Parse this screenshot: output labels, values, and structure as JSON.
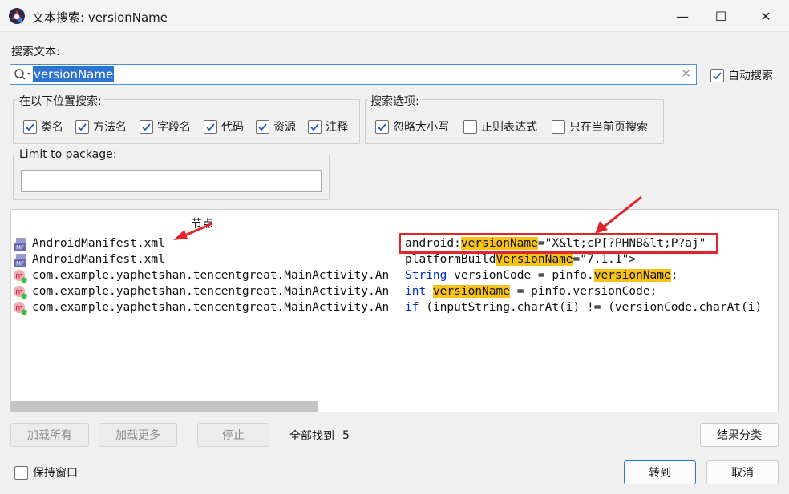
{
  "window": {
    "title": "文本搜索: versionName",
    "minimize_label": "—",
    "maximize_label": "☐",
    "close_label": "✕"
  },
  "search": {
    "label": "搜索文本:",
    "value": "versionName",
    "auto_search_label": "自动搜索",
    "auto_search_checked": true
  },
  "scope": {
    "title": "在以下位置搜索:",
    "items": [
      {
        "label": "类名",
        "checked": true
      },
      {
        "label": "方法名",
        "checked": true
      },
      {
        "label": "字段名",
        "checked": true
      },
      {
        "label": "代码",
        "checked": true
      },
      {
        "label": "资源",
        "checked": true
      },
      {
        "label": "注释",
        "checked": true
      }
    ]
  },
  "options": {
    "title": "搜索选项:",
    "items": [
      {
        "label": "忽略大小写",
        "checked": true
      },
      {
        "label": "正则表达式",
        "checked": false
      },
      {
        "label": "只在当前页搜索",
        "checked": false
      }
    ]
  },
  "package": {
    "label": "Limit to package:",
    "value": ""
  },
  "results": {
    "column_node": "节点",
    "rows": [
      {
        "icon": "manifest-icon",
        "node": "AndroidManifest.xml",
        "code": [
          {
            "t": "android:",
            "c": ""
          },
          {
            "t": "versionName",
            "c": "hl"
          },
          {
            "t": "=\"X&lt;cP[?PHNB&lt;P?aj\"",
            "c": ""
          }
        ]
      },
      {
        "icon": "manifest-icon",
        "node": "AndroidManifest.xml",
        "code": [
          {
            "t": "platformBuild",
            "c": ""
          },
          {
            "t": "VersionName",
            "c": "hl"
          },
          {
            "t": "=\"7.1.1\">",
            "c": ""
          }
        ]
      },
      {
        "icon": "method-icon",
        "node": "com.example.yaphetshan.tencentgreat.MainActivity.An",
        "code": [
          {
            "t": "String",
            "c": "kw"
          },
          {
            "t": " versionCode = pinfo.",
            "c": ""
          },
          {
            "t": "versionName",
            "c": "hl"
          },
          {
            "t": ";",
            "c": ""
          }
        ]
      },
      {
        "icon": "method-icon",
        "node": "com.example.yaphetshan.tencentgreat.MainActivity.An",
        "code": [
          {
            "t": "int",
            "c": "kw"
          },
          {
            "t": " ",
            "c": ""
          },
          {
            "t": "versionName",
            "c": "hl"
          },
          {
            "t": " = pinfo.versionCode;",
            "c": ""
          }
        ]
      },
      {
        "icon": "method-icon",
        "node": "com.example.yaphetshan.tencentgreat.MainActivity.An",
        "code": [
          {
            "t": "if",
            "c": "kw"
          },
          {
            "t": " (inputString.charAt(i) != (versionCode.charAt(i)",
            "c": ""
          }
        ]
      }
    ]
  },
  "actions": {
    "load_all": "加载所有",
    "load_more": "加载更多",
    "stop": "停止",
    "found_label": "全部找到",
    "found_count": "5",
    "group_results": "结果分类"
  },
  "footer": {
    "keep_window_label": "保持窗口",
    "keep_window_checked": false,
    "goto_label": "转到",
    "cancel_label": "取消"
  }
}
